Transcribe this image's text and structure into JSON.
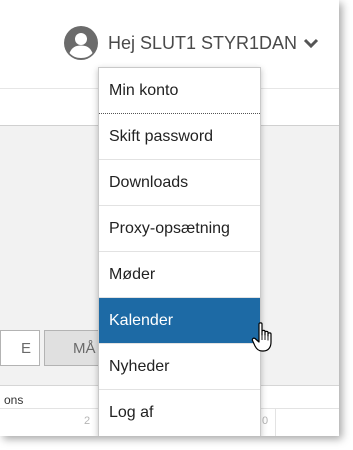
{
  "header": {
    "greeting": "Hej SLUT1 STYR1DAN",
    "avatar_icon": "user-circle-icon",
    "chevron_icon": "chevron-down-icon"
  },
  "menu": {
    "items": [
      {
        "label": "Min konto"
      },
      {
        "label": "Skift password"
      },
      {
        "label": "Downloads"
      },
      {
        "label": "Proxy-opsætning"
      },
      {
        "label": "Møder"
      },
      {
        "label": "Kalender",
        "active": true
      },
      {
        "label": "Nyheder"
      },
      {
        "label": "Log af"
      }
    ]
  },
  "background": {
    "chip_left": "E",
    "chip_right": "MÅ",
    "table_header": "ons",
    "cell_left": "2",
    "cell_right": "0"
  },
  "colors": {
    "active_item": "#1d6aa5",
    "text": "#4a4a4a"
  },
  "cursor_icon": "hand-pointer-icon"
}
